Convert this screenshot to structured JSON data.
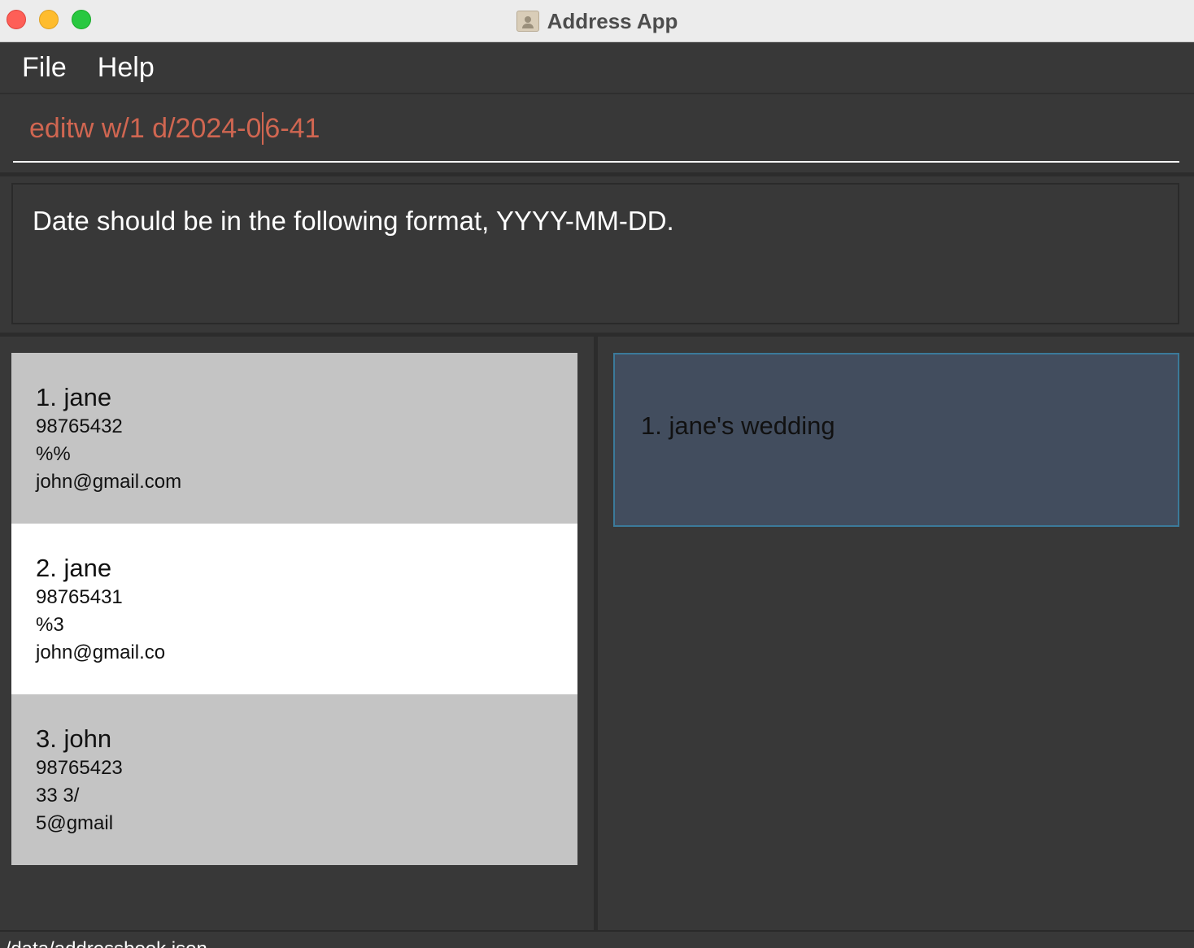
{
  "window": {
    "title": "Address App"
  },
  "menu": {
    "items": [
      "File",
      "Help"
    ]
  },
  "command": {
    "text_before_caret": "editw w/1 d/2024-0",
    "text_after_caret": "6-41"
  },
  "result": {
    "message": "Date should be in the following format, YYYY-MM-DD."
  },
  "persons": [
    {
      "name": "1. jane",
      "phone": "98765432",
      "address": "%%",
      "email": "john@gmail.com"
    },
    {
      "name": "2. jane",
      "phone": "98765431",
      "address": "%3",
      "email": "john@gmail.co"
    },
    {
      "name": "3. john",
      "phone": "98765423",
      "address": "33  3/",
      "email": "5@gmail"
    }
  ],
  "events": [
    {
      "label": "1. jane's wedding"
    }
  ],
  "status": {
    "path": "./data/addressbook.json"
  },
  "colors": {
    "background": "#383838",
    "command_error_text": "#d06651",
    "card_grey": "#c4c4c4",
    "card_selected": "#ffffff",
    "event_card": "#424d5e",
    "event_border": "#3b7a9a"
  }
}
